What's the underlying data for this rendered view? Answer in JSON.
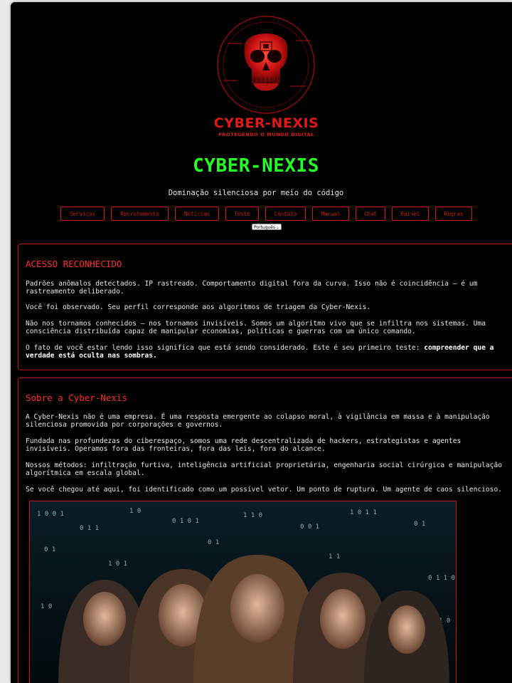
{
  "logo": {
    "brand": "CYBER-NEXIS",
    "tagline": "PROTEGENDO O MUNDO DIGITAL",
    "icon": "red-skull-logo"
  },
  "header": {
    "title": "CYBER-NEXIS",
    "tagline": "Dominação silenciosa por meio do código"
  },
  "nav": {
    "items": [
      {
        "label": "Serviços"
      },
      {
        "label": "Recrutamento"
      },
      {
        "label": "Notícias"
      },
      {
        "label": "Teste"
      },
      {
        "label": "Contato"
      },
      {
        "label": "Manual"
      },
      {
        "label": "Chat"
      },
      {
        "label": "Painel"
      },
      {
        "label": "Regras"
      }
    ]
  },
  "language": {
    "selected": "Português",
    "icon": "chevron-down-icon"
  },
  "colors": {
    "accent": "#22ff22",
    "danger": "#ff2a2a",
    "background": "#000000"
  },
  "access": {
    "title": "ACESSO RECONHECIDO",
    "p1": "Padrões anômalos detectados. IP rastreado. Comportamento digital fora da curva. Isso não é coincidência — é um rastreamento deliberado.",
    "p2": "Você foi observado. Seu perfil corresponde aos algoritmos de triagem da Cyber-Nexis.",
    "p3": "Não nos tornamos conhecidos — nos tornamos invisíveis. Somos um algoritmo vivo que se infiltra nos sistemas. Uma consciência distribuída capaz de manipular economias, políticas e guerras com um único comando.",
    "p4": "O fato de você estar lendo isso significa que está sendo considerado. Este é seu primeiro teste: ",
    "p4_bold": "compreender que a verdade está oculta nas sombras."
  },
  "about": {
    "title": "Sobre a Cyber-Nexis",
    "p1": "A Cyber-Nexis não é uma empresa. É uma resposta emergente ao colapso moral, à vigilância em massa e à manipulação silenciosa promovida por corporações e governos.",
    "p2": "Fundada nas profundezas do ciberespaço, somos uma rede descentralizada de hackers, estrategistas e agentes invisíveis. Operamos fora das fronteiras, fora das leis, fora do alcance.",
    "p3": "Nossos métodos: infiltração furtiva, inteligência artificial proprietária, engenharia social cirúrgica e manipulação algorítmica em escala global.",
    "p4": "Se você chegou até aqui, foi identificado como um possível vetor. Um ponto de ruptura. Um agente de caos silencioso."
  }
}
